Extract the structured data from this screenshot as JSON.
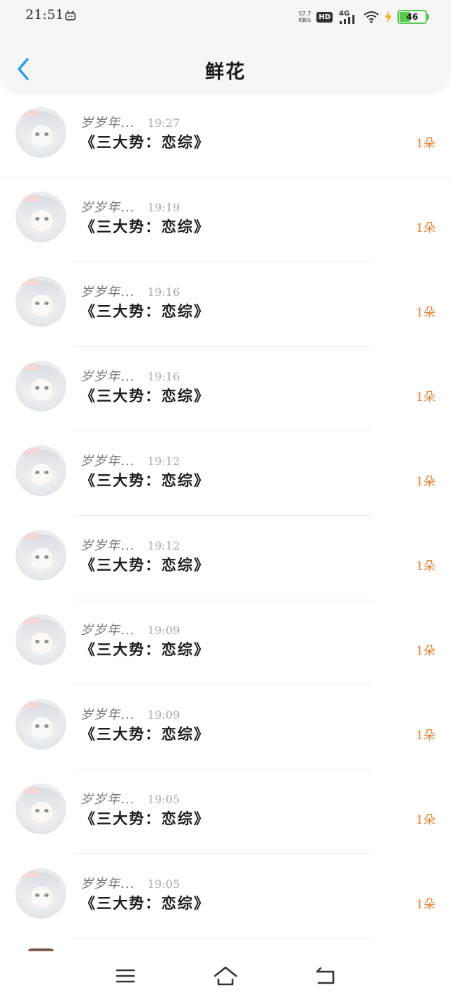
{
  "status_bar": {
    "time": "21:51",
    "net_speed_value": "57.7",
    "net_speed_unit": "KB/s",
    "hd_label": "HD",
    "network_label": "4G",
    "battery_level": "46",
    "battery_percent": 46,
    "battery_color": "#58c94f",
    "icons": [
      "bilibili-tv-icon",
      "signal-icon",
      "wifi-icon",
      "charging-bolt-icon",
      "battery-icon"
    ]
  },
  "header": {
    "title": "鲜花",
    "back_icon": "chevron-left-icon",
    "accent_color": "#2f9bec"
  },
  "list": {
    "items": [
      {
        "user": "岁岁年...",
        "time": "19:27",
        "book": "《三大势：恋综》",
        "count": "1朵"
      },
      {
        "user": "岁岁年...",
        "time": "19:19",
        "book": "《三大势：恋综》",
        "count": "1朵"
      },
      {
        "user": "岁岁年...",
        "time": "19:16",
        "book": "《三大势：恋综》",
        "count": "1朵"
      },
      {
        "user": "岁岁年...",
        "time": "19:16",
        "book": "《三大势：恋综》",
        "count": "1朵"
      },
      {
        "user": "岁岁年...",
        "time": "19:12",
        "book": "《三大势：恋综》",
        "count": "1朵"
      },
      {
        "user": "岁岁年...",
        "time": "19:12",
        "book": "《三大势：恋综》",
        "count": "1朵"
      },
      {
        "user": "岁岁年...",
        "time": "19:09",
        "book": "《三大势：恋综》",
        "count": "1朵"
      },
      {
        "user": "岁岁年...",
        "time": "19:09",
        "book": "《三大势：恋综》",
        "count": "1朵"
      },
      {
        "user": "岁岁年...",
        "time": "19:05",
        "book": "《三大势：恋综》",
        "count": "1朵"
      },
      {
        "user": "岁岁年...",
        "time": "19:05",
        "book": "《三大势：恋综》",
        "count": "1朵"
      }
    ],
    "count_color": "#e8853a"
  },
  "nav_bar": {
    "icons": [
      "menu-icon",
      "home-icon",
      "back-icon"
    ]
  }
}
